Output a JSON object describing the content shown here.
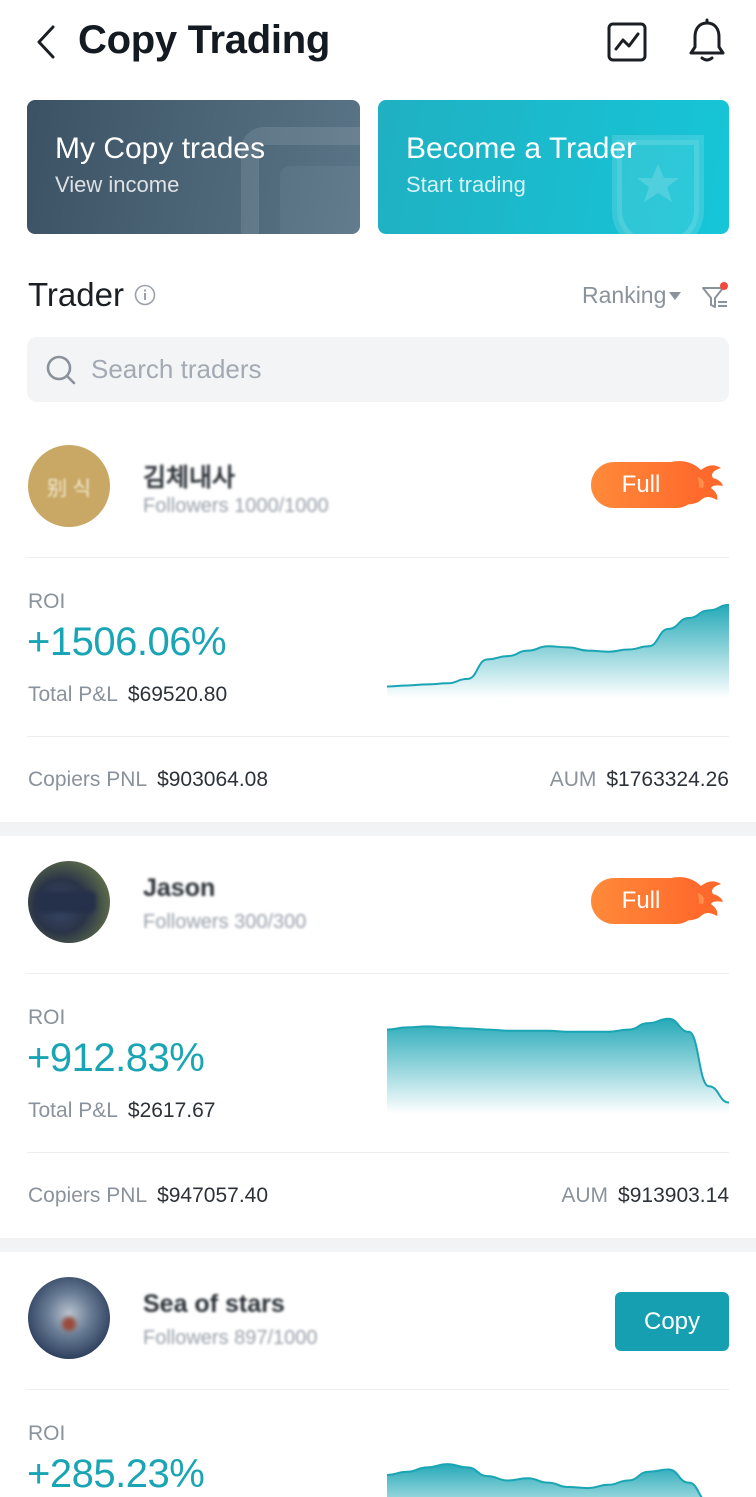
{
  "header": {
    "title": "Copy Trading",
    "back_icon": "chevron-left-icon",
    "chart_icon": "trend-chart-icon",
    "bell_icon": "bell-icon"
  },
  "banners": {
    "copy": {
      "title": "My Copy trades",
      "subtitle": "View income"
    },
    "become": {
      "title": "Become a Trader",
      "subtitle": "Start trading"
    }
  },
  "section": {
    "title": "Trader",
    "ranking_label": "Ranking",
    "filter_has_dot": true
  },
  "search": {
    "placeholder": "Search traders",
    "value": ""
  },
  "traders": [
    {
      "name": "김체내사",
      "avatar_text": "别 식",
      "followers": "Followers 1000/1000",
      "status": "Full",
      "roi_label": "ROI",
      "roi": "+1506.06%",
      "pnl_label": "Total P&L",
      "pnl": "$69520.80",
      "copiers_label": "Copiers PNL",
      "copiers_pnl": "$903064.08",
      "aum_label": "AUM",
      "aum": "$1763324.26",
      "sparkline": [
        5,
        6,
        7,
        8,
        12,
        30,
        33,
        38,
        42,
        41,
        38,
        37,
        39,
        42,
        58,
        68,
        75,
        80
      ]
    },
    {
      "name": "Jason",
      "followers": "Followers 300/300",
      "status": "Full",
      "roi_label": "ROI",
      "roi": "+912.83%",
      "pnl_label": "Total P&L",
      "pnl": "$2617.67",
      "copiers_label": "Copiers PNL",
      "copiers_pnl": "$947057.40",
      "aum_label": "AUM",
      "aum": "$913903.14",
      "sparkline": [
        72,
        74,
        75,
        74,
        73,
        72,
        71,
        71,
        71,
        70,
        70,
        70,
        72,
        78,
        82,
        70,
        20,
        5
      ]
    },
    {
      "name": "Sea of stars",
      "followers": "Followers 897/1000",
      "status": "Copy",
      "roi_label": "ROI",
      "roi": "+285.23%",
      "sparkline": [
        45,
        48,
        52,
        55,
        52,
        44,
        40,
        42,
        38,
        34,
        33,
        36,
        40,
        48,
        50,
        38,
        20,
        5
      ]
    }
  ],
  "colors": {
    "accent": "#1aa5b4",
    "copy_button": "#169fb0",
    "full_badge": "#ff6a2c",
    "banner_dark": "#3b5264",
    "banner_teal": "#16c6d8"
  }
}
